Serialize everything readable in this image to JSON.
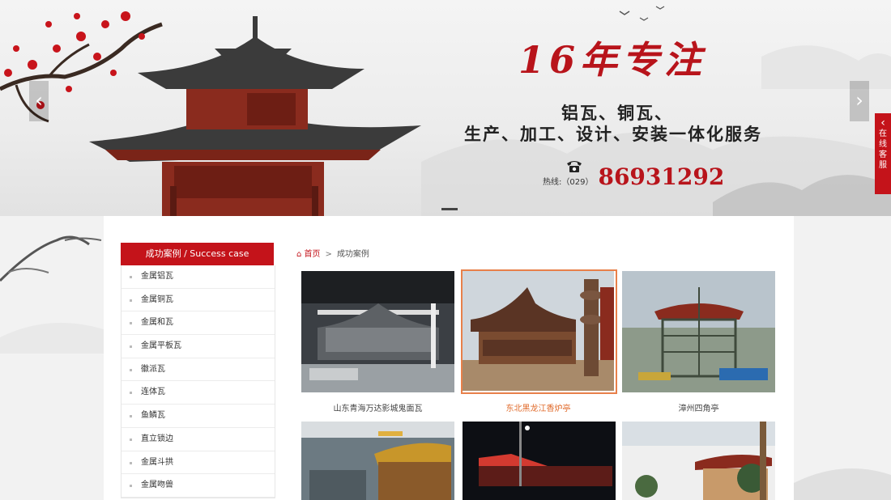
{
  "banner": {
    "headline": "16年专注",
    "line1": "铝瓦、铜瓦、",
    "line2": "生产、加工、设计、安装一体化服务",
    "hotline_label": "热线:（029）",
    "hotline_number": "86931292",
    "prev_icon": "chevron-left-icon",
    "next_icon": "chevron-right-icon"
  },
  "service_tab": {
    "label": "在线客服",
    "arrow": "‹"
  },
  "sidebar": {
    "title": "成功案例 / Success case",
    "items": [
      {
        "label": "金属铝瓦"
      },
      {
        "label": "金属铜瓦"
      },
      {
        "label": "金属和瓦"
      },
      {
        "label": "金属平板瓦"
      },
      {
        "label": "徽派瓦"
      },
      {
        "label": "连体瓦"
      },
      {
        "label": "鱼鳞瓦"
      },
      {
        "label": "直立锁边"
      },
      {
        "label": "金属斗拱"
      },
      {
        "label": "金属吻兽"
      }
    ]
  },
  "breadcrumb": {
    "home": "首页",
    "separator": ">",
    "current": "成功案例"
  },
  "cases": [
    {
      "caption": "山东青海万达影城鬼面瓦"
    },
    {
      "caption": "东北黑龙江香炉亭"
    },
    {
      "caption": "漳州四角亭"
    },
    {
      "caption": ""
    },
    {
      "caption": ""
    },
    {
      "caption": ""
    }
  ],
  "colors": {
    "accent": "#c4131a",
    "selected": "#e8804a"
  }
}
